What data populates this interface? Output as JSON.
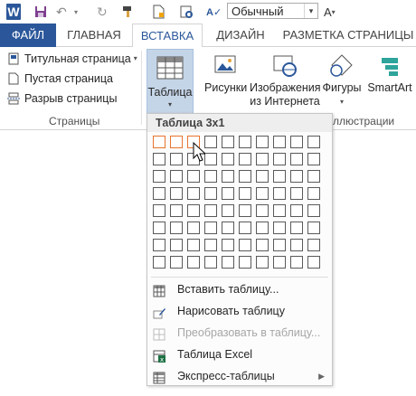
{
  "qat": {
    "style_value": "Обычный",
    "icons": [
      "word-logo",
      "save-icon",
      "undo-icon",
      "redo-icon",
      "format-painter-icon",
      "new-document-icon",
      "open-icon",
      "spelling-icon",
      "font-color-icon"
    ]
  },
  "tabs": [
    {
      "label": "ФАЙЛ"
    },
    {
      "label": "ГЛАВНАЯ"
    },
    {
      "label": "ВСТАВКА"
    },
    {
      "label": "ДИЗАЙН"
    },
    {
      "label": "РАЗМЕТКА СТРАНИЦЫ"
    }
  ],
  "ribbon": {
    "pages": {
      "cover": "Титульная страница",
      "blank": "Пустая страница",
      "break": "Разрыв страницы",
      "group_label": "Страницы"
    },
    "table_button": "Таблица",
    "pictures": "Рисунки",
    "online_pictures_1": "Изображения",
    "online_pictures_2": "из Интернета",
    "shapes": "Фигуры",
    "smartart": "SmartArt",
    "illustrations_label": "ллюстрации"
  },
  "menu": {
    "title": "Таблица 3x1",
    "grid": {
      "rows": 8,
      "cols": 10,
      "selected_cols": 3,
      "selected_rows": 1
    },
    "items": [
      {
        "label": "Вставить таблицу...",
        "disabled": false
      },
      {
        "label": "Нарисовать таблицу",
        "disabled": false
      },
      {
        "label": "Преобразовать в таблицу...",
        "disabled": true
      },
      {
        "label": "Таблица Excel",
        "disabled": false
      },
      {
        "label": "Экспресс-таблицы",
        "disabled": false,
        "submenu": true
      }
    ]
  },
  "colors": {
    "accent": "#2b579a",
    "selection": "#e8742f",
    "pressed": "#c5d5e8"
  }
}
